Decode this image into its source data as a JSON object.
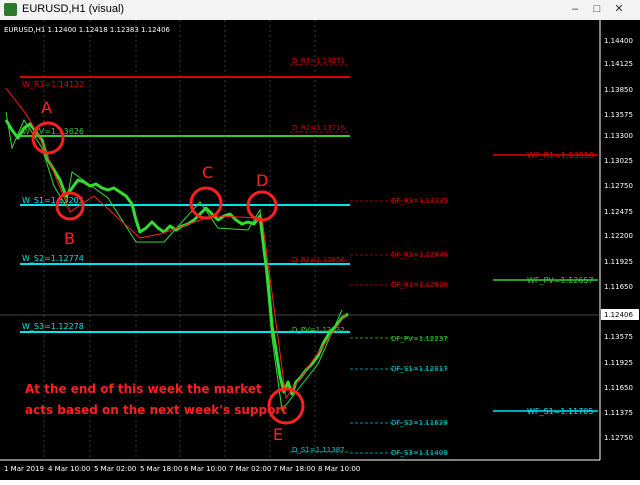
{
  "window": {
    "title": "EURUSD,H1 (visual)",
    "buttons": [
      "–",
      "□",
      "✕"
    ]
  },
  "chart": {
    "symbol_line": "EURUSD,H1  1.12400 1.12418 1.12383 1.12406",
    "current_price": "1.12406",
    "price_axis": [
      "1.14400",
      "1.14125",
      "1.13850",
      "1.13575",
      "1.13300",
      "1.13025",
      "1.12750",
      "1.12475",
      "1.12200",
      "1.11925",
      "1.11650",
      "1.11375"
    ],
    "time_axis": [
      "1 Mar 2019",
      "4 Mar 10:00",
      "5 Mar 02:00",
      "5 Mar 18:00",
      "6 Mar 10:00",
      "7 Mar 02:00",
      "7 Mar 18:00",
      "8 Mar 10:00"
    ],
    "weekly_levels": [
      {
        "label": "W_R1=1.14122",
        "color": "#e00000"
      },
      {
        "label": "W_PV=1.13626",
        "color": "#33cc33"
      },
      {
        "label": "W_S1=1.13205",
        "color": "#00e5ee"
      },
      {
        "label": "W_S2=1.12774",
        "color": "#00e5ee"
      },
      {
        "label": "W_S3=1.12278",
        "color": "#00e5ee"
      }
    ],
    "daily_labels": [
      {
        "label": "D_R3=1.14271",
        "color": "#d00000"
      },
      {
        "label": "D_R2=1.13716",
        "color": "#d00000"
      },
      {
        "label": "DF_R3=1.13235",
        "color": "#d00000"
      },
      {
        "label": "DF_R2=1.12846",
        "color": "#d00000"
      },
      {
        "label": "D_R1=1.12856",
        "color": "#d00000"
      },
      {
        "label": "DF_R1=1.12626",
        "color": "#d00000"
      },
      {
        "label": "D_PV=1.12332",
        "color": "#33cc33"
      },
      {
        "label": "DF_PV=1.12237",
        "color": "#33cc33"
      },
      {
        "label": "DF_S1=1.12017",
        "color": "#00c8d0"
      },
      {
        "label": "DF_S2=1.11628",
        "color": "#00c8d0"
      },
      {
        "label": "D_S1=1.11387",
        "color": "#00c8d0"
      },
      {
        "label": "DF_S3=1.11408",
        "color": "#00c8d0"
      }
    ],
    "weekly_forecast": [
      {
        "label": "WF_R1=1.13558",
        "color": "#e00000"
      },
      {
        "label": "WF_PV=1.12657",
        "color": "#33cc33"
      },
      {
        "label": "WF_S1=1.11705",
        "color": "#00e5ee"
      }
    ],
    "markers": [
      "A",
      "B",
      "C",
      "D",
      "E"
    ],
    "note_line1": "At the end of this week the market",
    "note_line2": "acts based on the next week's support",
    "colors": {
      "background": "#000000",
      "candle": "#33dd33",
      "annotation": "#ff2020",
      "grid": "#ffffff"
    }
  }
}
